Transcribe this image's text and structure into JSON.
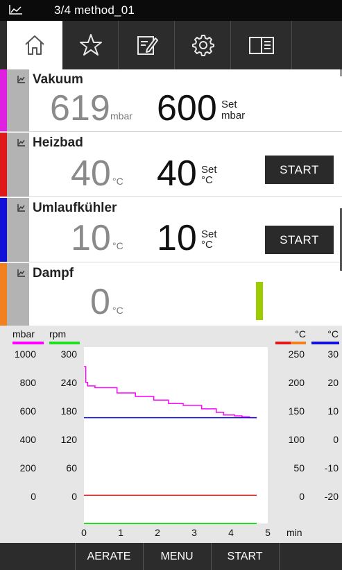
{
  "titlebar": {
    "title": "3/4 method_01"
  },
  "tabs": [
    {
      "name": "home",
      "icon": "home-icon",
      "active": true
    },
    {
      "name": "favorites",
      "icon": "star-icon",
      "active": false
    },
    {
      "name": "edit",
      "icon": "edit-icon",
      "active": false
    },
    {
      "name": "settings",
      "icon": "gear-icon",
      "active": false
    },
    {
      "name": "manual",
      "icon": "book-icon",
      "active": false
    }
  ],
  "panels": {
    "vakuum": {
      "name": "Vakuum",
      "value": "619",
      "unit": "mbar",
      "set_value": "600",
      "set_label": "Set",
      "set_unit": "mbar",
      "color": "#e020e0"
    },
    "heizbad": {
      "name": "Heizbad",
      "value": "40",
      "unit": "°C",
      "set_value": "40",
      "set_label": "Set",
      "set_unit": "°C",
      "button": "START",
      "color": "#e01818"
    },
    "umlauf": {
      "name": "Umlaufkühler",
      "value": "10",
      "unit": "°C",
      "set_value": "10",
      "set_label": "Set",
      "set_unit": "°C",
      "button": "START",
      "color": "#1010d8"
    },
    "dampf": {
      "name": "Dampf",
      "value": "0",
      "unit": "°C",
      "color": "#f08020",
      "indicator_color": "#9ccc00"
    }
  },
  "chart": {
    "left_axis1_label": "mbar",
    "left_axis2_label": "rpm",
    "right_axis1_label": "°C",
    "right_axis2_label": "°C",
    "xlabel_unit": "min"
  },
  "chart_data": {
    "type": "line",
    "x_ticks": [
      0,
      1,
      2,
      3,
      4,
      5
    ],
    "xlim": [
      0,
      5
    ],
    "axes": {
      "mbar": {
        "ticks": [
          1000,
          800,
          600,
          400,
          200,
          0
        ],
        "ylim": [
          0,
          1000
        ],
        "color": "#ff00ff"
      },
      "rpm": {
        "ticks": [
          300,
          240,
          180,
          120,
          60,
          0
        ],
        "ylim": [
          0,
          300
        ],
        "color": "#22dd22"
      },
      "heat_c": {
        "ticks": [
          250,
          200,
          150,
          100,
          50,
          0
        ],
        "ylim": [
          0,
          250
        ],
        "colors": [
          "#e01818",
          "#f08020"
        ]
      },
      "cool_c": {
        "ticks": [
          30,
          20,
          10,
          0,
          -10,
          -20
        ],
        "ylim": [
          -20,
          30
        ],
        "color": "#1010d8"
      }
    },
    "series": [
      {
        "axis": "mbar",
        "color": "#ff00ff",
        "step": true,
        "x": [
          0,
          0.05,
          0.1,
          0.3,
          0.9,
          1.4,
          1.9,
          2.3,
          2.7,
          3.2,
          3.6,
          3.8,
          4.1,
          4.3,
          4.5,
          4.7
        ],
        "y": [
          890,
          800,
          780,
          770,
          740,
          720,
          700,
          680,
          670,
          650,
          630,
          615,
          610,
          605,
          600,
          600
        ]
      },
      {
        "axis": "cool_c",
        "color": "#1010d8",
        "x": [
          0,
          4.7
        ],
        "y": [
          10,
          10
        ]
      },
      {
        "axis": "heat_c",
        "color": "#e01818",
        "x": [
          0,
          4.7
        ],
        "y": [
          40,
          40
        ]
      },
      {
        "axis": "rpm",
        "color": "#22dd22",
        "x": [
          0,
          4.7
        ],
        "y": [
          0,
          0
        ]
      }
    ]
  },
  "bottom": {
    "aerate": "AERATE",
    "menu": "MENU",
    "start": "START"
  }
}
